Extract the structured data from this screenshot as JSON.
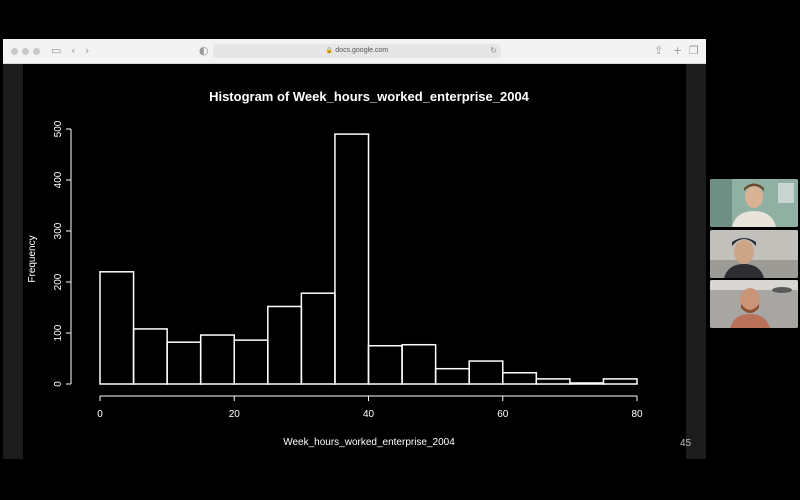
{
  "browser": {
    "url": "docs.google.com",
    "icons": [
      "sidebar-icon",
      "back-icon",
      "forward-icon",
      "shield-icon",
      "lock-icon",
      "reload-icon",
      "share-icon",
      "new-tab-icon",
      "tabs-icon"
    ]
  },
  "slide": {
    "page_number": "45"
  },
  "participants": [
    {
      "name": "",
      "tile": "video-tile"
    },
    {
      "name": "",
      "tile": "video-tile"
    },
    {
      "name": "",
      "tile": "video-tile"
    }
  ],
  "colors": {
    "background": "#000000",
    "chart_stroke": "#ffffff",
    "toolbar": "#f3f3f3"
  },
  "chart_data": {
    "type": "bar",
    "title": "Histogram of Week_hours_worked_enterprise_2004",
    "xlabel": "Week_hours_worked_enterprise_2004",
    "ylabel": "Frequency",
    "bin_edges": [
      0,
      5,
      10,
      15,
      20,
      25,
      30,
      35,
      40,
      45,
      50,
      55,
      60,
      65,
      70,
      75,
      80
    ],
    "values": [
      220,
      108,
      82,
      96,
      86,
      152,
      178,
      490,
      75,
      77,
      30,
      45,
      22,
      10,
      2,
      10
    ],
    "xlim": [
      0,
      80
    ],
    "ylim": [
      0,
      500
    ],
    "xticks": [
      "0",
      "20",
      "40",
      "60",
      "80"
    ],
    "yticks": [
      "0",
      "100",
      "200",
      "300",
      "400",
      "500"
    ],
    "grid": false
  }
}
